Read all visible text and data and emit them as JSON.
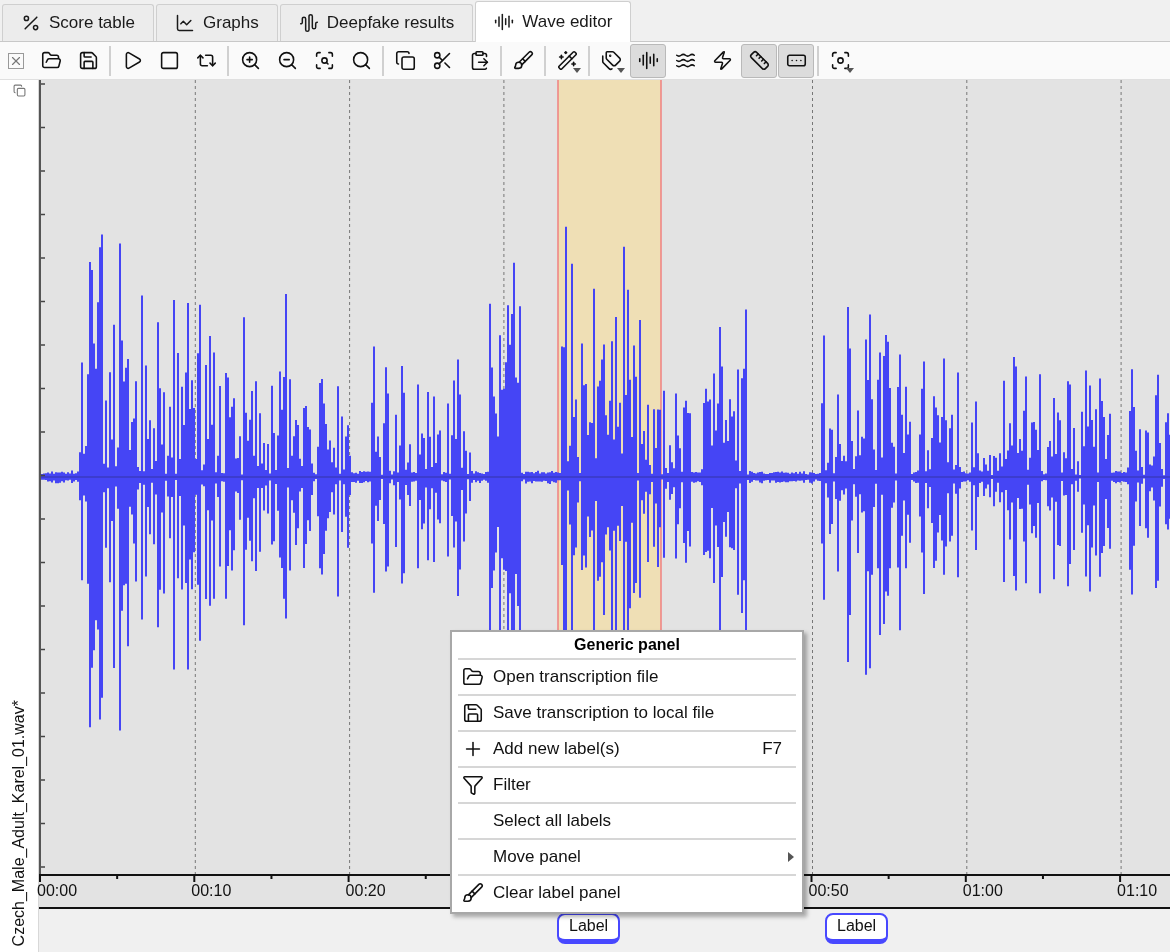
{
  "tabs": [
    {
      "label": "Score table",
      "selected": false
    },
    {
      "label": "Graphs",
      "selected": false
    },
    {
      "label": "Deepfake results",
      "selected": false
    },
    {
      "label": "Wave editor",
      "selected": true
    }
  ],
  "toolbar": [
    [
      {
        "pressed": false,
        "dropdown": false
      },
      {
        "pressed": false,
        "dropdown": false
      }
    ],
    [
      {
        "pressed": false,
        "dropdown": false
      },
      {
        "pressed": false,
        "dropdown": false
      },
      {
        "pressed": false,
        "dropdown": false
      }
    ],
    [
      {
        "pressed": false,
        "dropdown": false
      },
      {
        "pressed": false,
        "dropdown": false
      },
      {
        "pressed": false,
        "dropdown": false
      },
      {
        "pressed": false,
        "dropdown": false
      }
    ],
    [
      {
        "pressed": false,
        "dropdown": false
      },
      {
        "pressed": false,
        "dropdown": false
      },
      {
        "pressed": false,
        "dropdown": false
      }
    ],
    [
      {
        "pressed": false,
        "dropdown": false
      }
    ],
    [
      {
        "pressed": false,
        "dropdown": true
      }
    ],
    [
      {
        "pressed": false,
        "dropdown": true
      },
      {
        "pressed": true,
        "dropdown": false
      },
      {
        "pressed": false,
        "dropdown": false
      },
      {
        "pressed": false,
        "dropdown": false
      },
      {
        "pressed": true,
        "dropdown": false
      },
      {
        "pressed": true,
        "dropdown": false
      }
    ],
    [
      {
        "pressed": false,
        "dropdown": true
      }
    ]
  ],
  "file_name": "Czech_Male_Adult_Karel_01.wav*",
  "timeline": {
    "ticks": [
      "00:00",
      "00:10",
      "00:20",
      "00:50",
      "01:00",
      "01:10"
    ]
  },
  "labels": [
    {
      "text": "Label"
    },
    {
      "text": "Label"
    }
  ],
  "context_menu": {
    "title": "Generic panel",
    "items": [
      {
        "kind": "open",
        "label": "Open transcription file"
      },
      {
        "kind": "save",
        "label": "Save transcription to local file"
      },
      {
        "kind": "add",
        "label": "Add new label(s)",
        "shortcut": "F7"
      },
      {
        "kind": "filter",
        "label": "Filter"
      },
      {
        "kind": "plain",
        "label": "Select all labels"
      },
      {
        "kind": "submenu",
        "label": "Move panel"
      },
      {
        "kind": "clear",
        "label": "Clear label panel"
      }
    ]
  }
}
